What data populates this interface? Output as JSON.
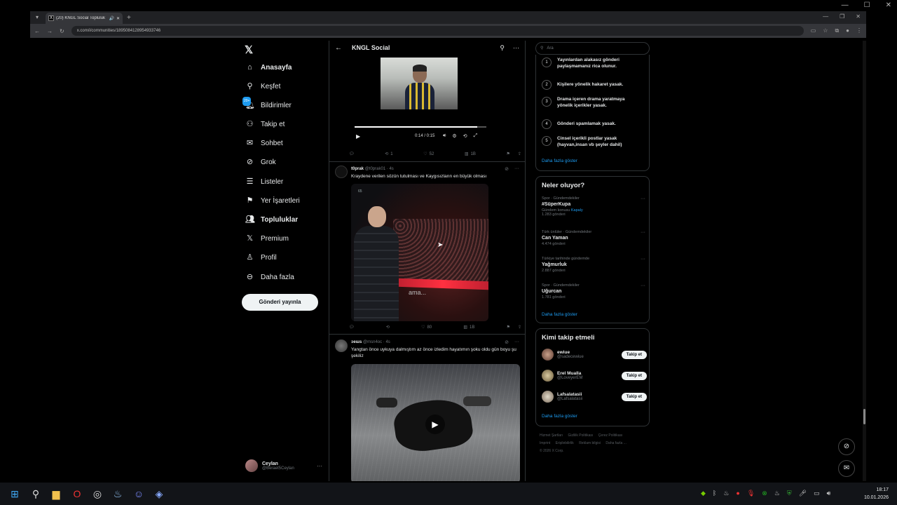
{
  "browser": {
    "tab_title": "(20) KNGL Social Topluluk",
    "url": "x.com/i/communities/1895084128954933746"
  },
  "nav": {
    "items": [
      {
        "label": "Anasayfa"
      },
      {
        "label": "Keşfet"
      },
      {
        "label": "Bildirimler",
        "badge": "20+"
      },
      {
        "label": "Takip et"
      },
      {
        "label": "Sohbet"
      },
      {
        "label": "Grok"
      },
      {
        "label": "Listeler"
      },
      {
        "label": "Yer İşaretleri"
      },
      {
        "label": "Topluluklar"
      },
      {
        "label": "Premium"
      },
      {
        "label": "Profil"
      },
      {
        "label": "Daha fazla"
      }
    ],
    "post_button": "Gönderi yayınla",
    "user": {
      "name": "Ceylan",
      "handle": "@Beraet5Ceylan"
    }
  },
  "header": {
    "title": "KNGL Social"
  },
  "video1": {
    "time": "0:14 / 0:15",
    "progress": 0.93
  },
  "post1_actions": {
    "replies": "",
    "reposts": "1",
    "likes": "52",
    "views": "1B"
  },
  "post2": {
    "name": "t0prak",
    "handle": "@t0prak01 · 4s",
    "text": "Kraydene verilen sözün tutulması ve Kaygısızların en büyük olması",
    "media_caption": "ama...",
    "media_tag": "65",
    "actions": {
      "replies": "",
      "reposts": "",
      "likes": "80",
      "views": "1B"
    }
  },
  "post3": {
    "name": "ɔeɯs",
    "handle": "@msn4oc · 4s",
    "text": "Yangtan önce uykuya dalmıştım az önce izledim hayatımın şoku oldu gün boyu şu şekiliz"
  },
  "right": {
    "search_placeholder": "Ara",
    "rules": [
      {
        "num": "1",
        "text": "Yayınlardan alakasız gönderi paylaşmamanız rica olunur."
      },
      {
        "num": "2",
        "text": "Kişilere yönelik hakaret yasak."
      },
      {
        "num": "3",
        "text": "Drama içeren drama yaratmaya yönelik içerikler yasak."
      },
      {
        "num": "4",
        "text": "Gönderi spamlamak yasak."
      },
      {
        "num": "5",
        "text": "Cinsel içerikli postlar yasak (hayvan,insan vb şeyler dahil)"
      }
    ],
    "rules_more": "Daha fazla göster",
    "trends_title": "Neler oluyor?",
    "trends": [
      {
        "meta": "Spor · Gündemdekiler",
        "name": "#SüperKupa",
        "extra_label": "Gündem konusu",
        "extra_link": "Kapaly",
        "count": "1.283 gönderi"
      },
      {
        "meta": "Türk ünlüler · Gündemdekiler",
        "name": "Can Yaman",
        "count": "4.474 gönderi"
      },
      {
        "meta": "Türkiye tarihinde gündemde",
        "name": "Yağmurluk",
        "count": "2.887 gönderi"
      },
      {
        "meta": "Spor · Gündemdekiler",
        "name": "Uğurcan",
        "count": "1.781 gönderi"
      }
    ],
    "trends_more": "Daha fazla göster",
    "follow_title": "Kimi takip etmeli",
    "follow": [
      {
        "name": "ewiue",
        "handle": "@sadecewiue",
        "btn": "Takip et"
      },
      {
        "name": "Erel Mualla",
        "handle": "@LoveyerEM",
        "btn": "Takip et"
      },
      {
        "name": "Lafsalatasii",
        "handle": "@Lafsalatasii",
        "btn": "Takip et"
      }
    ],
    "follow_more": "Daha fazla göster",
    "footer": [
      "Hizmet Şartları",
      "Gizlilik Politikası",
      "Çerez Politikası",
      "Imprint",
      "Erişilebilirlik",
      "Reklam bilgisi",
      "Daha fazla ...",
      "© 2026 X Corp."
    ]
  },
  "taskbar": {
    "time": "18:17",
    "date": "10.01.2026"
  }
}
